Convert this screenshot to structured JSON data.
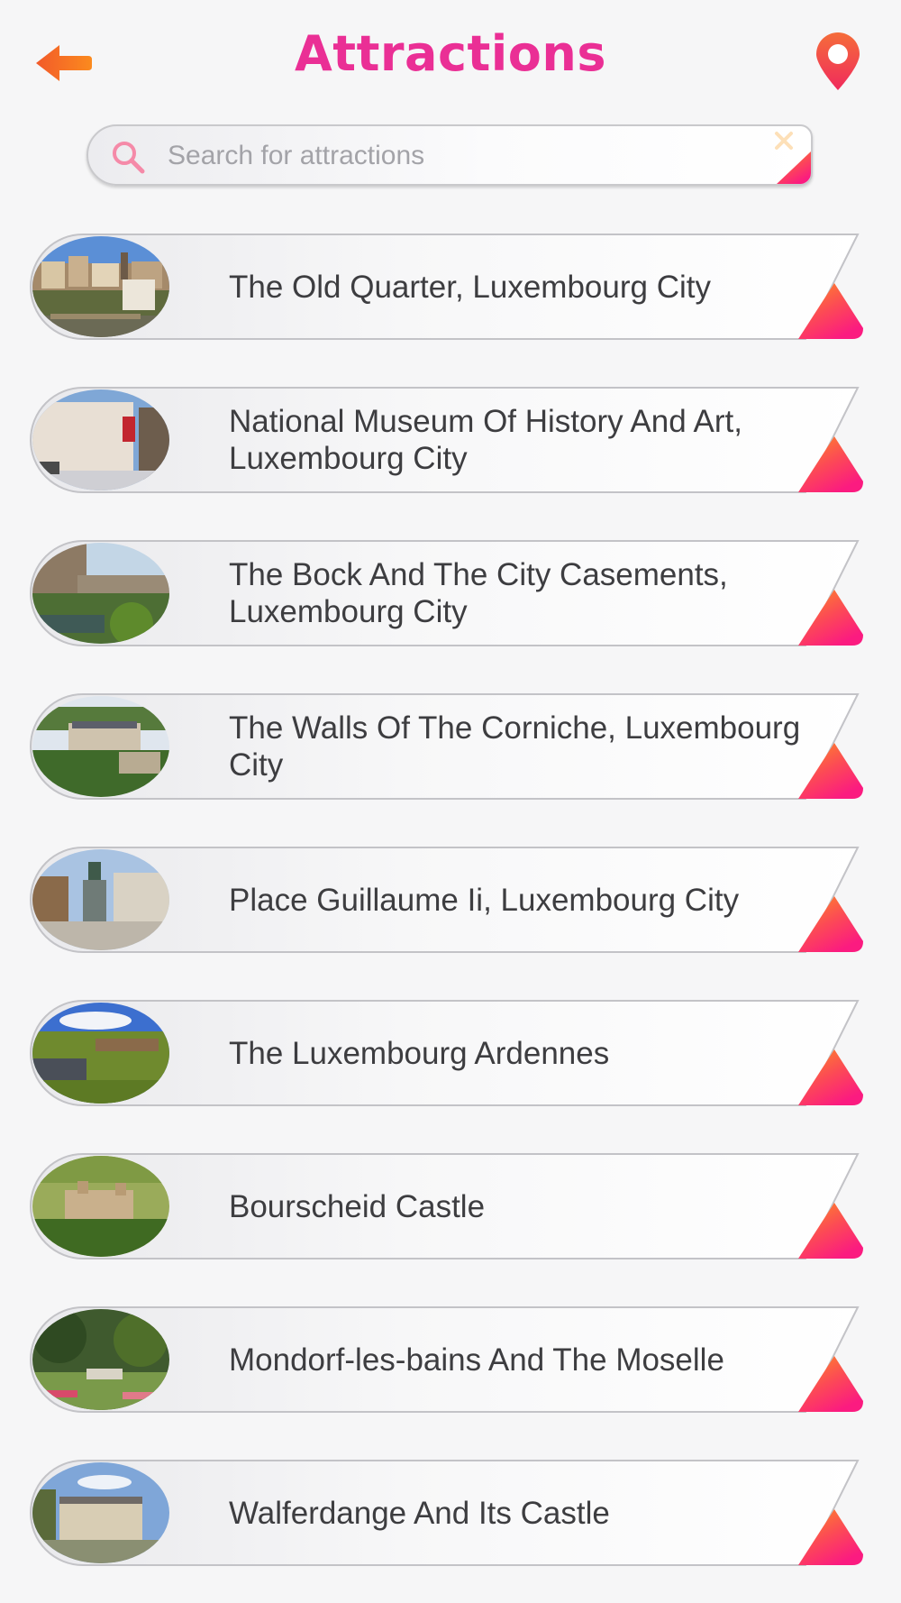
{
  "header": {
    "title": "Attractions"
  },
  "search": {
    "placeholder": "Search for attractions",
    "value": ""
  },
  "attractions": [
    {
      "name": "The Old Quarter, Luxembourg City"
    },
    {
      "name": "National Museum Of History And Art, Luxembourg City"
    },
    {
      "name": "The Bock And The City Casements, Luxembourg City"
    },
    {
      "name": "The Walls Of The Corniche, Luxembourg City"
    },
    {
      "name": "Place Guillaume Ii, Luxembourg City"
    },
    {
      "name": "The Luxembourg Ardennes"
    },
    {
      "name": "Bourscheid Castle"
    },
    {
      "name": "Mondorf-les-bains And The Moselle"
    },
    {
      "name": "Walferdange And Its Castle"
    }
  ],
  "colors": {
    "accent_pink": "#ea2f95",
    "accent_orange": "#f7701d",
    "gradient_start": "#fe8a23",
    "gradient_end": "#fb1f7c",
    "text": "#3d3d40",
    "placeholder": "#a3a3a8"
  },
  "icons": {
    "back": "arrow-left-icon",
    "location": "map-pin-icon",
    "search": "magnifier-icon",
    "clear": "close-icon",
    "corner": "triangle-corner-icon"
  }
}
